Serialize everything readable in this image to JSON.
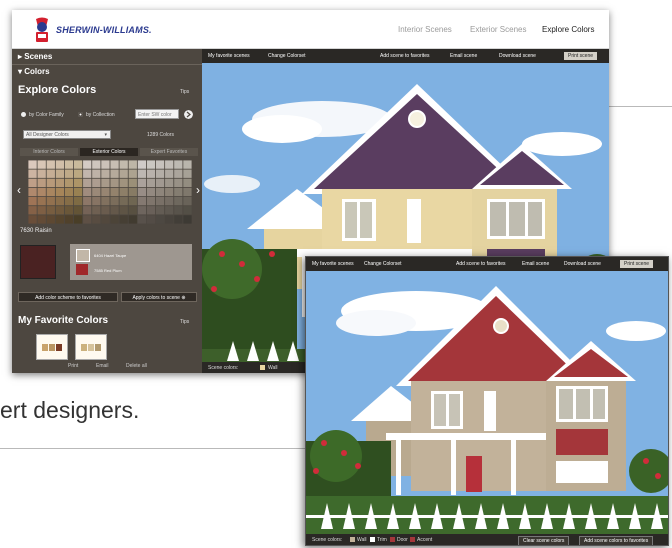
{
  "header": {
    "brand": "SHERWIN-WILLIAMS.",
    "nav": [
      "Interior Scenes",
      "Exterior Scenes",
      "Explore Colors"
    ],
    "active_nav": "Explore Colors"
  },
  "sidebar": {
    "sections": [
      "Scenes",
      "Colors"
    ],
    "title": "Explore Colors",
    "tips": "Tips",
    "radio_family": "by Color Family",
    "radio_collection": "by Collection",
    "search_placeholder": "Enter SW color",
    "color_count": "1289 Colors",
    "collection_select": "All Designer Colors",
    "tabs": [
      "Interior Colors",
      "Exterior Colors",
      "Expert Favorites"
    ],
    "selected_color": "7630 Raisin",
    "palette": [
      "6404 Hazel Taupe",
      "7585 Red Plum"
    ],
    "add_scheme_button": "Add color scheme to favorites",
    "apply_button": "Apply colors to scene",
    "favorites_title": "My Favorite Colors",
    "favorites_tips": "Tips",
    "footer_links": [
      "Print",
      "Email",
      "Delete all"
    ]
  },
  "scene": {
    "toolbar_links": [
      "My favorite scenes",
      "Change Colorset"
    ],
    "add_favorites": "Add scene to favorites",
    "email": "Email scene",
    "download": "Download scene",
    "print": "Print scene",
    "scene_colors_label": "Scene colors:",
    "scene_colors": [
      "Wall"
    ]
  },
  "scene2": {
    "toolbar_links": [
      "My favorite scenes",
      "Change Colorset"
    ],
    "add_favorites": "Add scene to favorites",
    "email": "Email scene",
    "download": "Download scene",
    "print": "Print scene",
    "scene_colors_label": "Scene colors:",
    "scene_colors": [
      "Wall",
      "Trim",
      "Door",
      "Accent"
    ],
    "clear_button": "Clear scene colors",
    "add_button": "Add scene colors to favorites"
  },
  "page": {
    "tagline": "ert designers."
  },
  "colors": {
    "sidebar_bg": "#4d4740",
    "wall_main": "#e9d7a3",
    "gable_main": "#5b3f62",
    "wall_alt": "#bfae98",
    "gable_alt": "#a4363a",
    "sky": "#87b7e4",
    "brand_blue": "#2b3a8f"
  }
}
